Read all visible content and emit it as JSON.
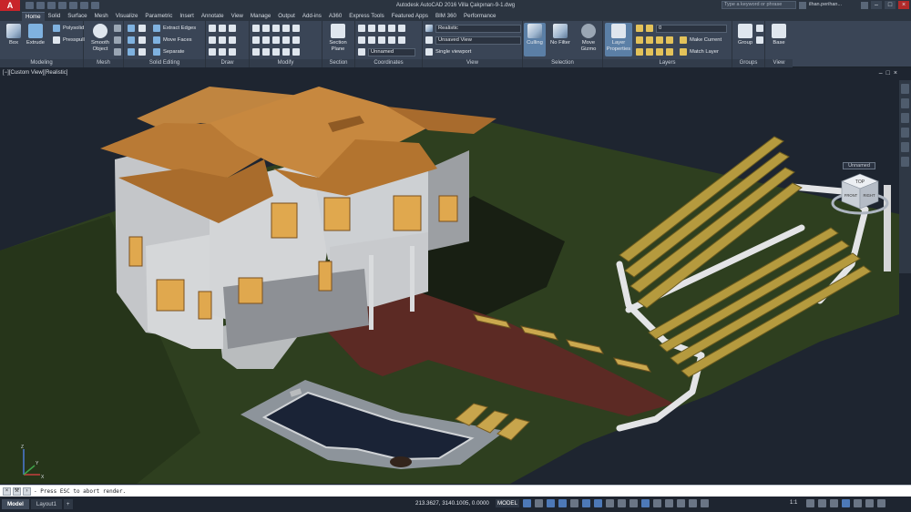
{
  "window": {
    "title": "Autodesk AutoCAD 2016   Villa Çakpınarı-9-1.dwg",
    "search_placeholder": "Type a keyword or phrase",
    "user": "ilhan.perihan...",
    "app_letter": "A"
  },
  "ribbon_tabs": [
    {
      "label": "Home",
      "active": true
    },
    {
      "label": "Solid"
    },
    {
      "label": "Surface"
    },
    {
      "label": "Mesh"
    },
    {
      "label": "Visualize"
    },
    {
      "label": "Parametric"
    },
    {
      "label": "Insert"
    },
    {
      "label": "Annotate"
    },
    {
      "label": "View"
    },
    {
      "label": "Manage"
    },
    {
      "label": "Output"
    },
    {
      "label": "Add-ins"
    },
    {
      "label": "A360"
    },
    {
      "label": "Express Tools"
    },
    {
      "label": "Featured Apps"
    },
    {
      "label": "BIM 360"
    },
    {
      "label": "Performance"
    }
  ],
  "panels": {
    "modeling": {
      "title": "Modeling",
      "box": "Box",
      "extrude": "Extrude",
      "polysolid": "Polysolid",
      "presspull": "Presspull"
    },
    "mesh": {
      "title": "Mesh",
      "smooth_object": "Smooth Object"
    },
    "solid_editing": {
      "title": "Solid Editing",
      "extract_edges": "Extract Edges",
      "move_faces": "Move Faces",
      "separate": "Separate"
    },
    "draw": {
      "title": "Draw"
    },
    "modify": {
      "title": "Modify"
    },
    "section": {
      "title": "Section",
      "section_plane": "Section Plane"
    },
    "coordinates": {
      "title": "Coordinates",
      "ucs_dropdown": "Unnamed"
    },
    "view": {
      "title": "View",
      "visual_style": "Realistic",
      "saved_view": "Unsaved View",
      "viewport": "Single viewport"
    },
    "selection": {
      "title": "Selection",
      "culling": "Culling",
      "no_filter": "No Filter",
      "move_gizmo": "Move Gizmo"
    },
    "layers": {
      "title": "Layers",
      "layer_properties": "Layer Properties",
      "layer_dropdown": "0",
      "make_current": "Make Current",
      "match_layer": "Match Layer"
    },
    "groups": {
      "title": "Groups",
      "group": "Group"
    },
    "view2": {
      "title": "View",
      "base": "Base"
    }
  },
  "viewport": {
    "label": "[−][Custom View][Realistic]",
    "viewcube_top": "TOP",
    "viewcube_front": "FRONT",
    "viewcube_right": "RIGHT",
    "viewcube_chip": "Unnamed",
    "ucs_x": "X",
    "ucs_y": "Y",
    "ucs_z": "Z"
  },
  "command_line": {
    "text": "- Press ESC to abort render."
  },
  "status": {
    "tabs": [
      "Model",
      "Layout1"
    ],
    "coordinates": "213.3627, 3140.1005, 0.0000",
    "model_space": "MODEL",
    "scale": "1:1"
  },
  "colors": {
    "roof": "#b97a35",
    "wall": "#c9cbce",
    "lawn": "#2e3f1f",
    "patio": "#5c2a24",
    "pool_water": "#1a2336",
    "bench_wood": "#b59a3e",
    "bench_frame": "#e6e6e6",
    "background": "#1e2530"
  }
}
